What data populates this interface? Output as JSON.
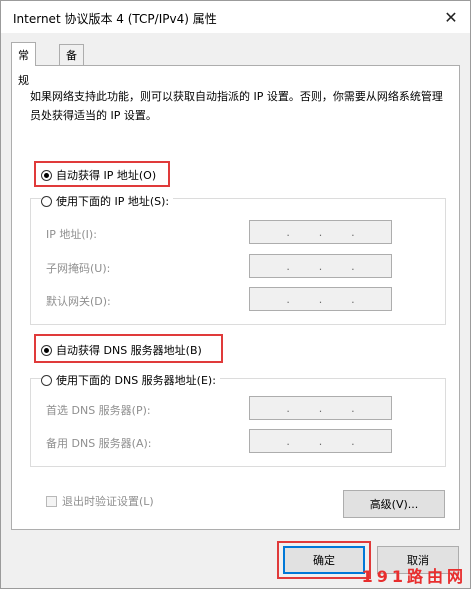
{
  "window": {
    "title": "Internet 协议版本 4 (TCP/IPv4) 属性",
    "close_glyph": "✕"
  },
  "tabs": [
    {
      "label": "常规",
      "active": true
    },
    {
      "label": "备用配置",
      "active": false
    }
  ],
  "description": "如果网络支持此功能，则可以获取自动指派的 IP 设置。否则，你需要从网络系统管理员处获得适当的 IP 设置。",
  "ip_section": {
    "auto_label": "自动获得 IP 地址(O)",
    "auto_selected": true,
    "manual_label": "使用下面的 IP 地址(S):",
    "manual_selected": false,
    "fields": [
      {
        "label": "IP 地址(I):",
        "value": ". . ."
      },
      {
        "label": "子网掩码(U):",
        "value": ". . ."
      },
      {
        "label": "默认网关(D):",
        "value": ". . ."
      }
    ]
  },
  "dns_section": {
    "auto_label": "自动获得 DNS 服务器地址(B)",
    "auto_selected": true,
    "manual_label": "使用下面的 DNS 服务器地址(E):",
    "manual_selected": false,
    "fields": [
      {
        "label": "首选 DNS 服务器(P):",
        "value": ". . ."
      },
      {
        "label": "备用 DNS 服务器(A):",
        "value": ". . ."
      }
    ]
  },
  "validate_checkbox": {
    "label": "退出时验证设置(L)",
    "checked": false
  },
  "buttons": {
    "advanced": "高级(V)...",
    "ok": "确定",
    "cancel": "取消"
  },
  "watermark": "191路由网",
  "colors": {
    "highlight": "#e03a3a",
    "watermark": "#e82e2e",
    "focus": "#0078d7"
  }
}
